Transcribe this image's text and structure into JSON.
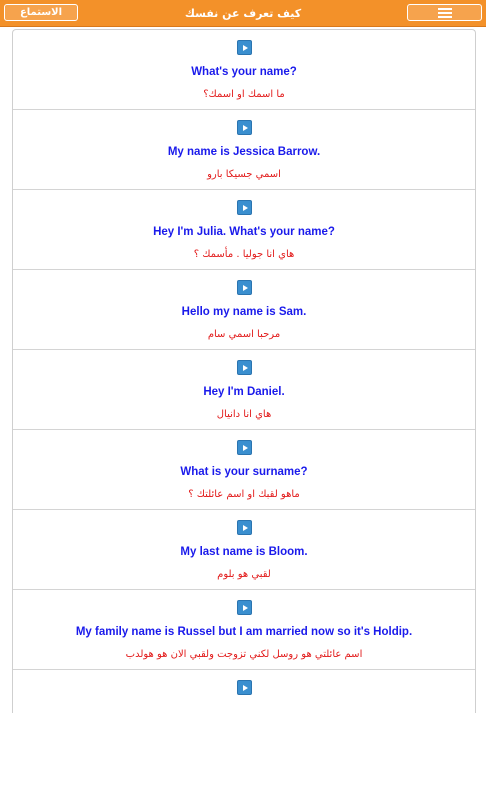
{
  "header": {
    "title": "كيف تعرف عن نفسك",
    "listen_label": "الاستماع",
    "menu_icon": "hamburger-icon"
  },
  "colors": {
    "topbar": "#f39129",
    "english_text": "#1a1aeb",
    "arabic_text": "#e21a1a",
    "play_button": "#3a8fcf"
  },
  "phrases": [
    {
      "en": "What's your name?",
      "ar": "ما اسمك او اسمك؟"
    },
    {
      "en": "My name is Jessica Barrow.",
      "ar": "اسمي جسيكا بارو"
    },
    {
      "en": "Hey I'm Julia. What's your name?",
      "ar": "هاي انا جوليا . مأسمك ؟"
    },
    {
      "en": "Hello my name is Sam.",
      "ar": "مرحبا اسمي سام"
    },
    {
      "en": "Hey I'm Daniel.",
      "ar": "هاي انا دانيال"
    },
    {
      "en": "What is your surname?",
      "ar": "ماهو لقبك او اسم عائلتك ؟"
    },
    {
      "en": "My last name is Bloom.",
      "ar": "لقبي هو بلوم"
    },
    {
      "en": "My family name is Russel but I am married now so it's Holdip.",
      "ar": "اسم عائلتي هو روسل لكني تزوجت ولقبي الان هو هولدب"
    },
    {
      "en": "",
      "ar": ""
    }
  ]
}
